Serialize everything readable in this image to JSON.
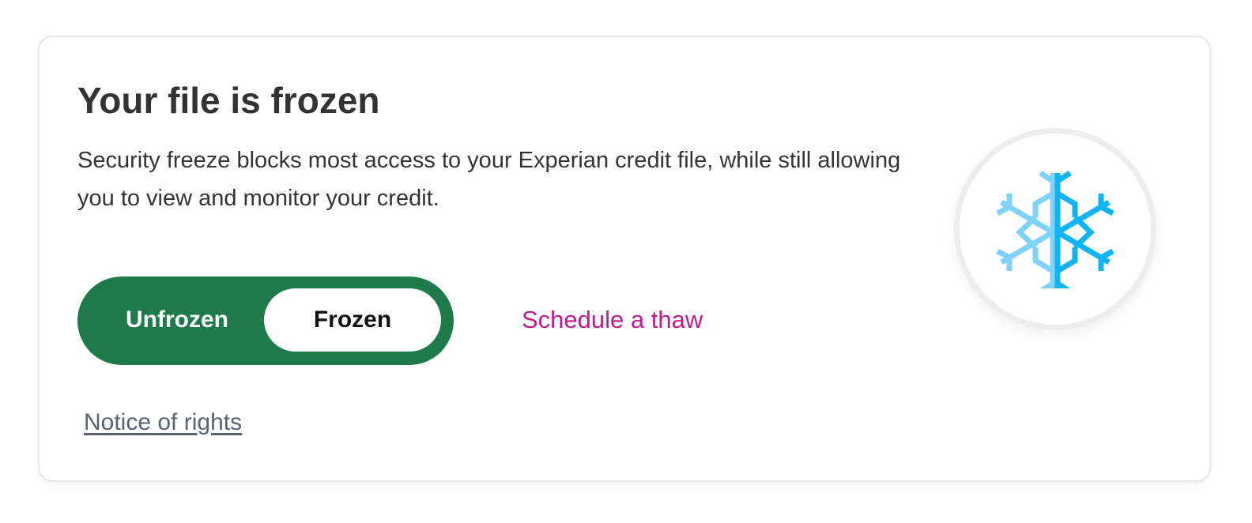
{
  "card": {
    "title": "Your file is frozen",
    "description": "Security freeze blocks most access to your Experian credit file, while still allowing you to view and monitor your credit."
  },
  "freeze_toggle": {
    "options": [
      "Unfrozen",
      "Frozen"
    ],
    "selected": "Frozen",
    "active_color": "#1f7a4b"
  },
  "links": {
    "schedule_thaw": "Schedule a thaw",
    "notice_of_rights": "Notice of rights",
    "accent_color": "#c01b8e"
  },
  "status_icon": {
    "name": "snowflake-icon",
    "colors": [
      "#7fd3fb",
      "#10b4f2"
    ]
  }
}
